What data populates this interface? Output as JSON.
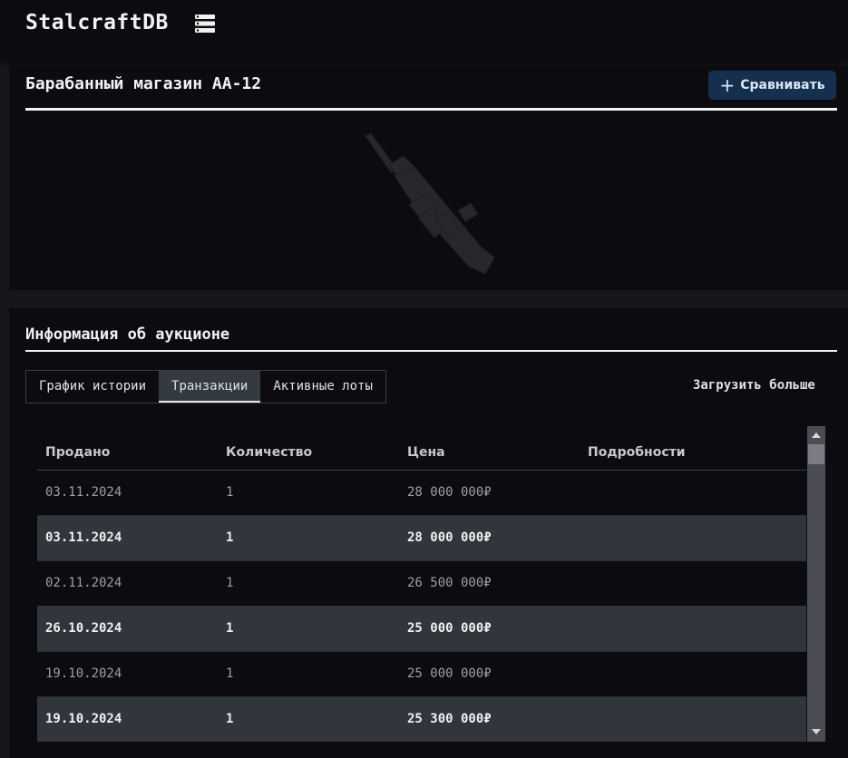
{
  "header": {
    "brand": "StalcraftDB",
    "menu_icon": "list-icon"
  },
  "item": {
    "title": "Барабанный магазин AA-12",
    "compare_label": "Сравнивать",
    "compare_icon": "plus-icon",
    "image": "aa12-weapon-image"
  },
  "auction": {
    "title": "Информация об аукционе",
    "tabs": [
      {
        "label": "График истории",
        "active": false
      },
      {
        "label": "Транзакции",
        "active": true
      },
      {
        "label": "Активные лоты",
        "active": false
      }
    ],
    "load_more": "Загрузить больше",
    "columns": [
      "Продано",
      "Количество",
      "Цена",
      "Подробности"
    ],
    "rows": [
      {
        "date": "03.11.2024",
        "qty": "1",
        "price": "28 000 000₽",
        "details": ""
      },
      {
        "date": "03.11.2024",
        "qty": "1",
        "price": "28 000 000₽",
        "details": ""
      },
      {
        "date": "02.11.2024",
        "qty": "1",
        "price": "26 500 000₽",
        "details": ""
      },
      {
        "date": "26.10.2024",
        "qty": "1",
        "price": "25 000 000₽",
        "details": ""
      },
      {
        "date": "19.10.2024",
        "qty": "1",
        "price": "25 000 000₽",
        "details": ""
      },
      {
        "date": "19.10.2024",
        "qty": "1",
        "price": "25 300 000₽",
        "details": ""
      }
    ]
  },
  "colors": {
    "background": "#16171b",
    "card": "#0c0c10",
    "accent_button": "#15304f",
    "row_alt": "#31363d"
  }
}
